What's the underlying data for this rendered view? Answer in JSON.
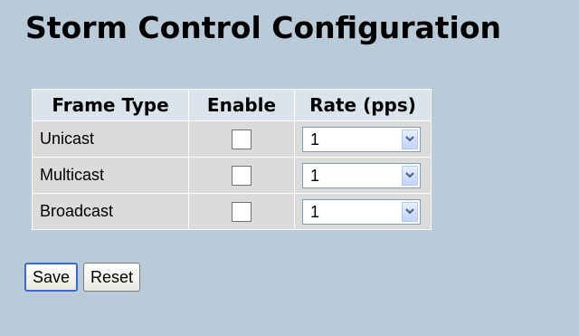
{
  "page": {
    "title": "Storm Control Configuration"
  },
  "table": {
    "headers": {
      "frame_type": "Frame Type",
      "enable": "Enable",
      "rate": "Rate (pps)"
    },
    "rows": [
      {
        "frame_type": "Unicast",
        "enabled": false,
        "rate": "1"
      },
      {
        "frame_type": "Multicast",
        "enabled": false,
        "rate": "1"
      },
      {
        "frame_type": "Broadcast",
        "enabled": false,
        "rate": "1"
      }
    ]
  },
  "buttons": {
    "save_label": "Save",
    "reset_label": "Reset"
  },
  "icons": {
    "checkbox": "checkbox-icon",
    "dropdown": "chevron-down-icon"
  },
  "colors": {
    "background": "#b9cad8",
    "header_row": "#dbe4ec",
    "data_row": "#dbdbdb"
  }
}
